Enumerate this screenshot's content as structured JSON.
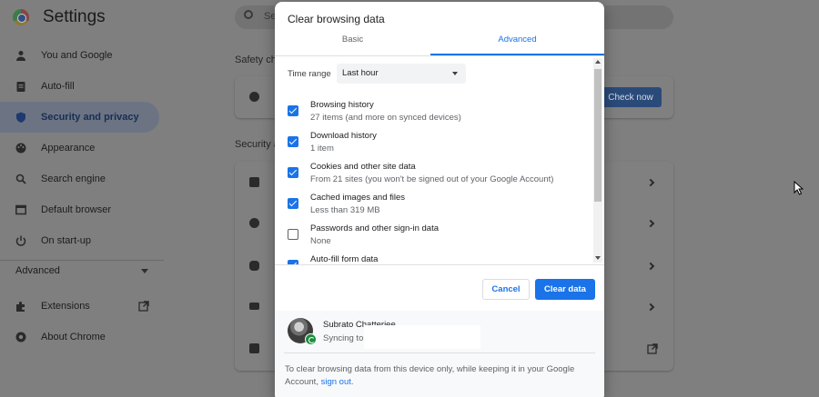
{
  "app": {
    "title": "Settings"
  },
  "search": {
    "placeholder": "Se"
  },
  "sidebar": {
    "items": [
      {
        "label": "You and Google",
        "icon": "person-icon"
      },
      {
        "label": "Auto-fill",
        "icon": "clipboard-icon"
      },
      {
        "label": "Security and privacy",
        "icon": "shield-icon",
        "active": true
      },
      {
        "label": "Appearance",
        "icon": "palette-icon"
      },
      {
        "label": "Search engine",
        "icon": "search-icon"
      },
      {
        "label": "Default browser",
        "icon": "browser-icon"
      },
      {
        "label": "On start-up",
        "icon": "power-icon"
      }
    ],
    "advanced": "Advanced",
    "extensions": "Extensions",
    "about": "About Chrome"
  },
  "background": {
    "safety_check_title": "Safety ch",
    "check_now": "Check now",
    "security_title": "Security a"
  },
  "dialog": {
    "title": "Clear browsing data",
    "tabs": [
      "Basic",
      "Advanced"
    ],
    "active_tab": "Advanced",
    "time_range_label": "Time range",
    "time_range_value": "Last hour",
    "options": [
      {
        "title": "Browsing history",
        "sub": "27 items (and more on synced devices)",
        "checked": true
      },
      {
        "title": "Download history",
        "sub": "1 item",
        "checked": true
      },
      {
        "title": "Cookies and other site data",
        "sub": "From 21 sites (you won't be signed out of your Google Account)",
        "checked": true
      },
      {
        "title": "Cached images and files",
        "sub": "Less than 319 MB",
        "checked": true
      },
      {
        "title": "Passwords and other sign-in data",
        "sub": "None",
        "checked": false
      },
      {
        "title": "Auto-fill form data",
        "sub": "",
        "checked": true
      }
    ],
    "cancel": "Cancel",
    "clear": "Clear data",
    "account": {
      "name": "Subrato Chatterjee",
      "sync": "Syncing to"
    },
    "note_prefix": "To clear browsing data from this device only, while keeping it in your Google Account, ",
    "note_link": "sign out",
    "note_suffix": "."
  },
  "colors": {
    "accent": "#1a73e8",
    "overlay": "#7f7f7f",
    "sync_badge": "#1e8e3e"
  }
}
